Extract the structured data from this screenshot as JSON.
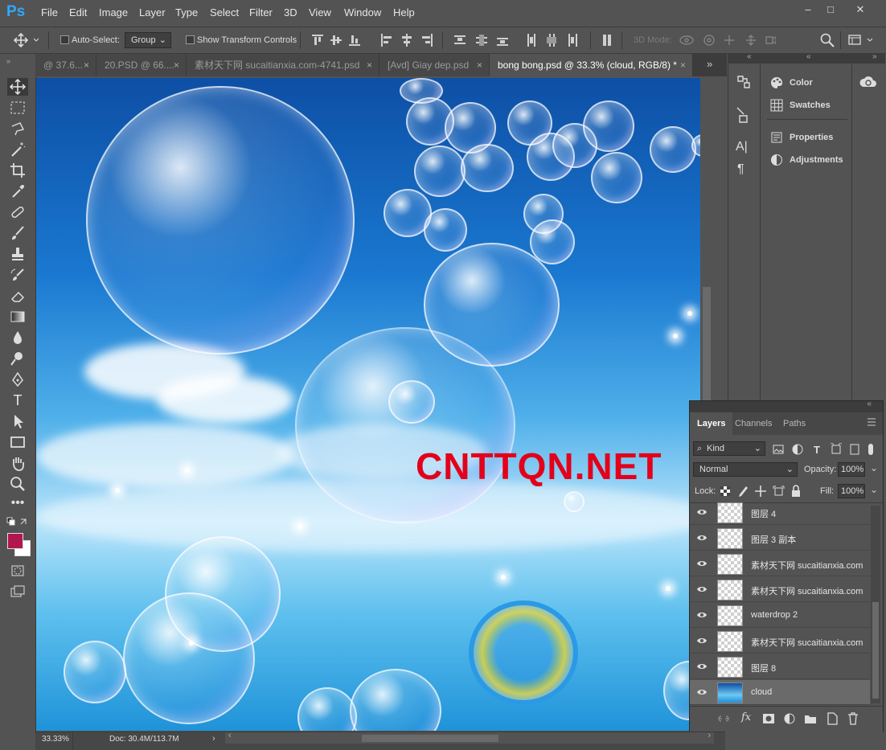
{
  "app": {
    "logo": "Ps"
  },
  "menu": [
    "File",
    "Edit",
    "Image",
    "Layer",
    "Type",
    "Select",
    "Filter",
    "3D",
    "View",
    "Window",
    "Help"
  ],
  "window_controls": {
    "minimize": "–",
    "maximize": "□",
    "close": "✕"
  },
  "options": {
    "auto_select_label": "Auto-Select:",
    "auto_select_value": "Group",
    "show_transform_label": "Show Transform Controls",
    "mode_3d_label": "3D Mode:"
  },
  "tabs": [
    {
      "label": "@ 37.6...",
      "active": false
    },
    {
      "label": "20.PSD @ 66....",
      "active": false
    },
    {
      "label": "素材天下网 sucaitianxia.com-4741.psd",
      "active": false
    },
    {
      "label": "[Avd] Giay dep.psd",
      "active": false
    },
    {
      "label": "bong bong.psd @ 33.3% (cloud, RGB/8) *",
      "active": true
    }
  ],
  "tab_overflow": "»",
  "canvas": {
    "watermark": "CNTTQN.NET"
  },
  "colors": {
    "foreground": "#b0174e",
    "background": "#ffffff",
    "watermark": "#e3001b",
    "accent": "#31a8ff"
  },
  "side_panels": [
    {
      "label": "Color",
      "icon": "palette-icon"
    },
    {
      "label": "Swatches",
      "icon": "grid-icon"
    },
    {
      "label": "Properties",
      "icon": "properties-icon"
    },
    {
      "label": "Adjustments",
      "icon": "adjustments-icon"
    }
  ],
  "layers_panel": {
    "tabs": [
      "Layers",
      "Channels",
      "Paths"
    ],
    "filter_label": "Kind",
    "blend_mode": "Normal",
    "opacity_label": "Opacity:",
    "opacity_value": "100%",
    "lock_label": "Lock:",
    "fill_label": "Fill:",
    "fill_value": "100%",
    "layers": [
      {
        "name": "图层 4",
        "selected": false
      },
      {
        "name": "图层 3 副本",
        "selected": false
      },
      {
        "name": "素材天下网 sucaitianxia.com",
        "selected": false
      },
      {
        "name": "素材天下网 sucaitianxia.com",
        "selected": false
      },
      {
        "name": "waterdrop 2",
        "selected": false
      },
      {
        "name": "素材天下网 sucaitianxia.com",
        "selected": false
      },
      {
        "name": "图层 8",
        "selected": false
      },
      {
        "name": "cloud",
        "selected": true
      }
    ],
    "footer_fx": "fx"
  },
  "status": {
    "zoom": "33.33%",
    "doc": "Doc: 30.4M/113.7M"
  }
}
